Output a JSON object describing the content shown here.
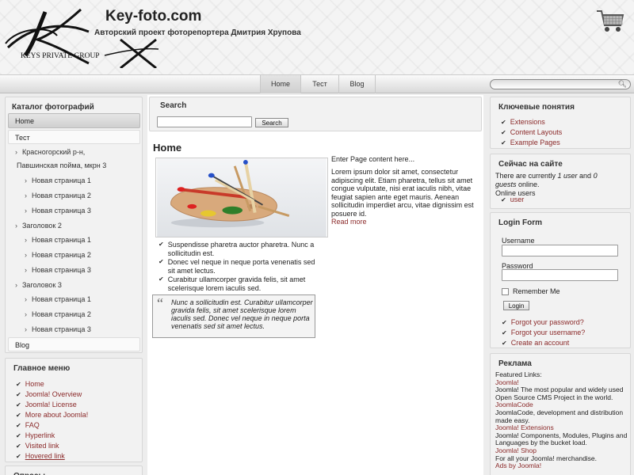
{
  "header": {
    "title": "Key-foto.com",
    "slogan": "Авторский проект фоторепортера Дмитрия Хрупова",
    "logo_text": "KEYS PRIVATE GROUP"
  },
  "nav": {
    "tabs": [
      "Home",
      "Тест",
      "Blog"
    ],
    "active": "Home"
  },
  "catalog": {
    "title": "Каталог фотографий",
    "items": [
      {
        "label": "Home"
      },
      {
        "label": "Тест"
      },
      {
        "label": "Красногорский р-н,"
      },
      {
        "label": "Павшинская пойма, мкрн 3"
      },
      {
        "label": "Новая страница 1"
      },
      {
        "label": "Новая страница 2"
      },
      {
        "label": "Новая страница 3"
      },
      {
        "label": "Заголовок 2"
      },
      {
        "label": "Новая страница 1"
      },
      {
        "label": "Новая страница 2"
      },
      {
        "label": "Новая страница 3"
      },
      {
        "label": "Заголовок 3"
      },
      {
        "label": "Новая страница 1"
      },
      {
        "label": "Новая страница 2"
      },
      {
        "label": "Новая страница 3"
      },
      {
        "label": "Blog"
      }
    ]
  },
  "main_menu": {
    "title": "Главное меню",
    "items": [
      "Home",
      "Joomla! Overview",
      "Joomla! License",
      "More about Joomla!",
      "FAQ",
      "Hyperlink",
      "Visited link",
      "Hovered link"
    ]
  },
  "polls": {
    "title": "Опросы"
  },
  "search": {
    "title": "Search",
    "button": "Search",
    "value": ""
  },
  "article": {
    "title": "Home",
    "intro": "Enter Page content here...",
    "body": "Lorem ipsum dolor sit amet, consectetur adipiscing elit. Etiam pharetra, tellus sit amet congue vulputate, nisi erat iaculis nibh, vitae feugiat sapien ante eget mauris. Aenean sollicitudin imperdiet arcu, vitae dignissim est posuere id.",
    "read_more": "Read more",
    "list": [
      "Suspendisse pharetra auctor pharetra. Nunc a sollicitudin est.",
      "Donec vel neque in neque porta venenatis sed sit amet lectus.",
      "Curabitur ullamcorper gravida felis, sit amet scelerisque lorem iaculis sed."
    ],
    "quote": "Nunc a sollicitudin est. Curabitur ullamcorper gravida felis, sit amet scelerisque lorem iaculis sed. Donec vel neque in neque porta venenatis sed sit amet lectus."
  },
  "keywords": {
    "title": "Ключевые понятия",
    "items": [
      "Extensions",
      "Content Layouts",
      "Example Pages"
    ]
  },
  "online": {
    "title": "Сейчас на сайте",
    "line1a": "There are currently ",
    "line1b": "1 user",
    "line1c": " and ",
    "line1d": "0",
    "line2a": "guests",
    "line2b": " online.",
    "line3": "Online users",
    "user": "user"
  },
  "login": {
    "title": "Login Form",
    "username_label": "Username",
    "password_label": "Password",
    "remember_label": "Remember Me",
    "button": "Login",
    "links": [
      "Forgot your password?",
      "Forgot your username?",
      "Create an account"
    ]
  },
  "ads": {
    "title": "Реклама",
    "intro": "Featured Links:",
    "entries": [
      {
        "link": "Joomla!",
        "text": "Joomla! The most popular and widely used Open Source CMS Project in the world."
      },
      {
        "link": "JoomlaCode",
        "text": "JoomlaCode, development and distribution made easy."
      },
      {
        "link": "Joomla! Extensions",
        "text": "Joomla! Components, Modules, Plugins and Languages by the bucket load."
      },
      {
        "link": "Joomla! Shop",
        "text": "For all your Joomla! merchandise."
      },
      {
        "link": "Ads by Joomla!",
        "text": ""
      }
    ]
  },
  "colors": {
    "link": "#8b2a2a",
    "accent": "#555555"
  }
}
